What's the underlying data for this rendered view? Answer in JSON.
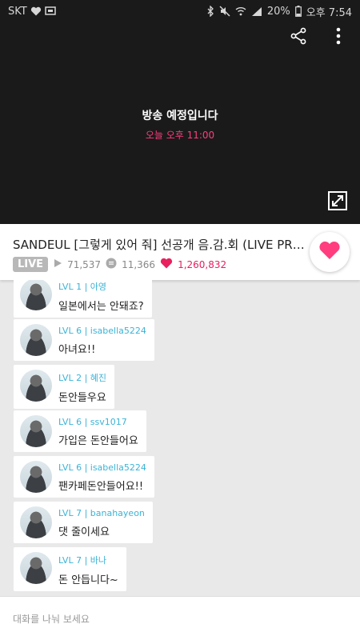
{
  "status_bar": {
    "carrier": "SKT",
    "battery": "20%",
    "time": "오후 7:54"
  },
  "player": {
    "message": "방송 예정입니다",
    "schedule": "오늘 오후 11:00"
  },
  "broadcast": {
    "title": "SANDEUL [그렇게 있어 줘] 선공개 음.감.회 (LIVE PREMI···",
    "live_label": "LIVE",
    "play_count": "71,537",
    "chat_count": "11,366",
    "like_count": "1,260,832"
  },
  "chat": {
    "messages": [
      {
        "user": "LVL 1 | 아영",
        "text": "일본에서는 안돼죠?"
      },
      {
        "user": "LVL 6 | isabella5224",
        "text": "아녀요!!"
      },
      {
        "user": "LVL 2 | 혜진",
        "text": "돈안들우요"
      },
      {
        "user": "LVL 6 | ssv1017",
        "text": "가입은 돈안들어요"
      },
      {
        "user": "LVL 6 | isabella5224",
        "text": "팬카페돈안들어요!!"
      },
      {
        "user": "LVL 7 | banahayeon",
        "text": "댓 줄이세요"
      },
      {
        "user": "LVL 7 | 바나",
        "text": "돈 안듭니다~"
      }
    ]
  },
  "input": {
    "placeholder": "대화를 나눠 보세요"
  },
  "colors": {
    "accent_pink": "#ff3d7f",
    "username_blue": "#3bb3d6",
    "player_bg": "#1a1a1a"
  },
  "icons": [
    "heart-icon",
    "message-icon",
    "bluetooth-icon",
    "mute-icon",
    "wifi-icon",
    "signal-icon",
    "battery-icon",
    "share-icon",
    "more-vertical-icon",
    "fullscreen-icon",
    "play-icon",
    "chat-icon"
  ]
}
